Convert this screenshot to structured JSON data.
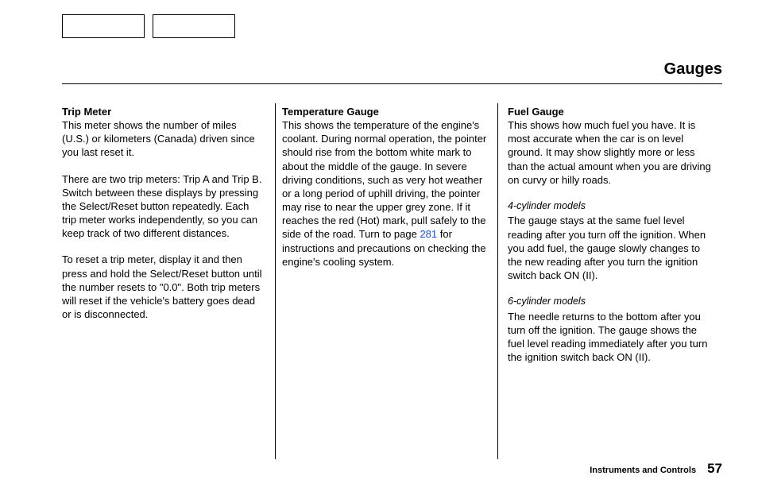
{
  "title": "Gauges",
  "col1": {
    "heading": "Trip Meter",
    "p1": "This meter shows the number of miles (U.S.) or kilometers (Canada) driven since you last reset it.",
    "p2": "There are two trip meters: Trip A and Trip B. Switch between these displays by pressing the Select/Reset button repeatedly. Each trip meter works independently, so you can keep track of two different distances.",
    "p3": "To reset a trip meter, display it and then press and hold the Select/Reset button until the number resets to \"0.0\". Both trip meters will reset if the vehicle's battery goes dead or is disconnected."
  },
  "col2": {
    "heading": "Temperature Gauge",
    "p1a": "This shows the temperature of the engine's coolant. During normal operation, the pointer should rise from the bottom white mark to about the middle of the gauge. In severe driving conditions, such as very hot weather or a long period of uphill driving, the pointer may rise to near the upper grey zone. If it reaches the red (Hot) mark, pull safely to the side of the road. Turn to page ",
    "link": "281",
    "p1b": " for instructions and precautions on checking the engine's cooling system."
  },
  "col3": {
    "heading": "Fuel Gauge",
    "p1": "This shows how much fuel you have. It is most accurate when the car is on level ground. It may show slightly more or less than the actual amount when you are driving on curvy or hilly roads.",
    "sub1": "4-cylinder models",
    "p2": "The gauge stays at the same fuel level reading after you turn off the ignition. When you add fuel, the gauge slowly changes to the new reading after you turn the ignition switch back ON (II).",
    "sub2": "6-cylinder models",
    "p3": "The needle returns to the bottom after you turn off the ignition. The gauge shows the fuel level reading immediately after you turn the ignition switch back ON (II)."
  },
  "footer": {
    "section": "Instruments and Controls",
    "page": "57"
  }
}
